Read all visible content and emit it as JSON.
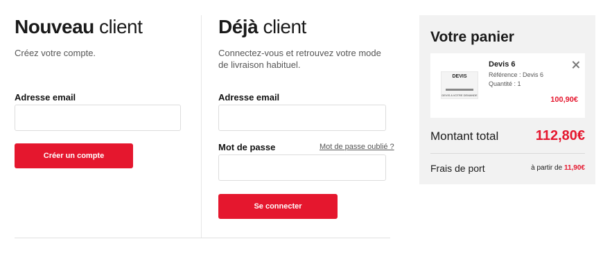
{
  "new_client": {
    "title_strong": "Nouveau",
    "title_light": "client",
    "subtitle": "Créez votre compte.",
    "email_label": "Adresse email",
    "email_value": "",
    "create_button": "Créer un compte"
  },
  "existing_client": {
    "title_strong": "Déjà",
    "title_light": "client",
    "subtitle": "Connectez-vous et retrouvez votre mode de livraison habituel.",
    "email_label": "Adresse email",
    "email_value": "",
    "password_label": "Mot de passe",
    "password_value": "",
    "forgot_link": "Mot de passe oublié ?",
    "login_button": "Se connecter"
  },
  "cart": {
    "title": "Votre panier",
    "item": {
      "name": "Devis 6",
      "reference": "Référence : Devis 6",
      "quantity": "Quantité : 1",
      "price": "100,90€",
      "thumb_title": "DEVIS",
      "thumb_subtitle": "DEVIS A VOTRE DEMANDE",
      "remove_icon": "close-icon"
    },
    "total_label": "Montant total",
    "total_value": "112,80€",
    "shipping_label": "Frais de port",
    "shipping_prefix": "à partir de",
    "shipping_value": "11,90€"
  },
  "colors": {
    "accent": "#e5172e",
    "cart_background": "#f2f2f2"
  }
}
